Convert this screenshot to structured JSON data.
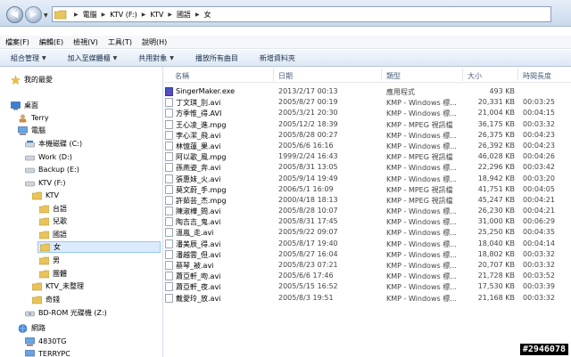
{
  "address": {
    "crumbs": [
      "電腦",
      "KTV (F:)",
      "KTV",
      "國語",
      "女"
    ]
  },
  "menu": [
    "檔案(F)",
    "編輯(E)",
    "檢視(V)",
    "工具(T)",
    "說明(H)"
  ],
  "commands": [
    {
      "label": "組合管理",
      "dropdown": true
    },
    {
      "label": "加入至媒體櫃",
      "dropdown": true
    },
    {
      "label": "共用對象",
      "dropdown": true
    },
    {
      "label": "播放所有曲目",
      "dropdown": false
    },
    {
      "label": "新增資料夾",
      "dropdown": false
    }
  ],
  "nav": {
    "favorites": "我的最愛",
    "desktop": "桌面",
    "user": "Terry",
    "computer": "電腦",
    "drives": [
      "本機磁碟 (C:)",
      "Work (D:)",
      "Backup (E:)",
      "KTV (F:)"
    ],
    "ktv": "KTV",
    "ktv_children": [
      "台語",
      "兒歌",
      "國語"
    ],
    "guoyu_children": [
      "女",
      "男",
      "團體"
    ],
    "ktv_unsorted": "KTV_未整理",
    "other": "奇錢",
    "bdrom": "BD-ROM 光碟機 (Z:)",
    "network": "網路",
    "hosts": [
      "4830TG",
      "TERRYPC"
    ]
  },
  "columns": {
    "name": "名稱",
    "date": "日期",
    "type": "類型",
    "size": "大小",
    "length": "時間長度"
  },
  "files": [
    {
      "name": "SingerMaker.exe",
      "date": "2013/2/17 00:13",
      "type": "應用程式",
      "size": "493 KB",
      "length": "",
      "kind": "exe"
    },
    {
      "name": "丁文琪_別.avi",
      "date": "2005/8/27 00:19",
      "type": "KMP - Windows 標...",
      "size": "20,331 KB",
      "length": "00:03:25",
      "kind": "avi"
    },
    {
      "name": "方季惟_得.AVI",
      "date": "2005/3/21 20:30",
      "type": "KMP - Windows 標...",
      "size": "21,004 KB",
      "length": "00:04:15",
      "kind": "avi"
    },
    {
      "name": "王心凌_進.mpg",
      "date": "2005/12/2 18:39",
      "type": "KMP - MPEG 視訊檔",
      "size": "36,175 KB",
      "length": "00:03:32",
      "kind": "mpg"
    },
    {
      "name": "李心潔_飛.avi",
      "date": "2005/8/28 00:27",
      "type": "KMP - Windows 標...",
      "size": "26,375 KB",
      "length": "00:04:23",
      "kind": "avi"
    },
    {
      "name": "林憶蓮_果.avi",
      "date": "2005/6/6 16:16",
      "type": "KMP - Windows 標...",
      "size": "26,392 KB",
      "length": "00:04:23",
      "kind": "avi"
    },
    {
      "name": "阿以歌_風.mpg",
      "date": "1999/2/24 16:43",
      "type": "KMP - MPEG 視訊檔",
      "size": "46,028 KB",
      "length": "00:04:26",
      "kind": "mpg"
    },
    {
      "name": "孫燕姿_奔.avi",
      "date": "2005/8/31 13:05",
      "type": "KMP - Windows 標...",
      "size": "22,296 KB",
      "length": "00:03:42",
      "kind": "avi"
    },
    {
      "name": "張惠妹_火.avi",
      "date": "2005/9/14 19:49",
      "type": "KMP - Windows 標...",
      "size": "18,942 KB",
      "length": "00:03:20",
      "kind": "avi"
    },
    {
      "name": "莫文蔚_手.mpg",
      "date": "2006/5/1 16:09",
      "type": "KMP - MPEG 視訊檔",
      "size": "41,751 KB",
      "length": "00:04:05",
      "kind": "mpg"
    },
    {
      "name": "許茹芸_杰.mpg",
      "date": "2000/4/18 18:13",
      "type": "KMP - MPEG 視訊檔",
      "size": "45,247 KB",
      "length": "00:04:21",
      "kind": "mpg"
    },
    {
      "name": "陳淑樺_問.avi",
      "date": "2005/8/28 10:07",
      "type": "KMP - Windows 標...",
      "size": "26,230 KB",
      "length": "00:04:21",
      "kind": "avi"
    },
    {
      "name": "陶吉吉_鬼.avi",
      "date": "2005/8/31 17:45",
      "type": "KMP - Windows 標...",
      "size": "31,000 KB",
      "length": "00:06:29",
      "kind": "avi"
    },
    {
      "name": "溫嵐_走.avi",
      "date": "2005/9/22 09:07",
      "type": "KMP - Windows 標...",
      "size": "25,250 KB",
      "length": "00:04:35",
      "kind": "avi"
    },
    {
      "name": "潘美辰_得.avi",
      "date": "2005/8/17 19:40",
      "type": "KMP - Windows 標...",
      "size": "18,040 KB",
      "length": "00:04:14",
      "kind": "avi"
    },
    {
      "name": "潘越雲_但.avi",
      "date": "2005/8/27 16:04",
      "type": "KMP - Windows 標...",
      "size": "18,802 KB",
      "length": "00:03:32",
      "kind": "avi"
    },
    {
      "name": "蔡琴_被.avi",
      "date": "2005/8/23 07:21",
      "type": "KMP - Windows 標...",
      "size": "20,707 KB",
      "length": "00:03:32",
      "kind": "avi"
    },
    {
      "name": "蕭亞軒_吻.avi",
      "date": "2005/6/6 17:46",
      "type": "KMP - Windows 標...",
      "size": "21,728 KB",
      "length": "00:03:52",
      "kind": "avi"
    },
    {
      "name": "蕭亞軒_夜.avi",
      "date": "2005/5/15 16:52",
      "type": "KMP - Windows 標...",
      "size": "17,530 KB",
      "length": "00:03:39",
      "kind": "avi"
    },
    {
      "name": "戴愛玲_放.avi",
      "date": "2005/8/3 19:51",
      "type": "KMP - Windows 標...",
      "size": "21,168 KB",
      "length": "00:03:32",
      "kind": "avi"
    }
  ],
  "watermark": "#2946078"
}
